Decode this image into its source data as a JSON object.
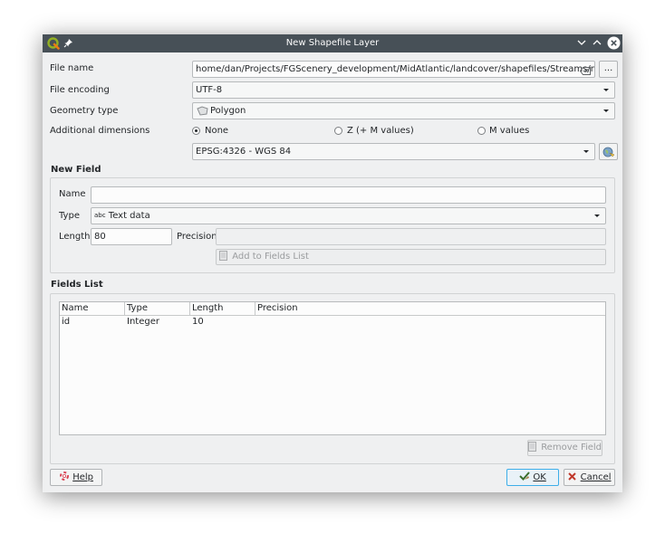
{
  "window": {
    "title": "New Shapefile Layer"
  },
  "form": {
    "file_name_label": "File name",
    "file_name_value": "home/dan/Projects/FGScenery_development/MidAtlantic/landcover/shapefiles/Streams/mask.shp",
    "browse_label": "...",
    "file_encoding_label": "File encoding",
    "file_encoding_value": "UTF-8",
    "geometry_type_label": "Geometry type",
    "geometry_type_value": "Polygon",
    "additional_dimensions_label": "Additional dimensions",
    "dimension_options": [
      "None",
      "Z (+ M values)",
      "M values"
    ],
    "dimension_selected": "None",
    "crs_value": "EPSG:4326 - WGS 84"
  },
  "new_field": {
    "title": "New Field",
    "name_label": "Name",
    "name_value": "",
    "type_label": "Type",
    "type_prefix": "abc",
    "type_value": "Text data",
    "length_label": "Length",
    "length_value": "80",
    "precision_label": "Precision",
    "precision_value": "",
    "add_button": "Add to Fields List"
  },
  "fields_list": {
    "title": "Fields List",
    "columns": [
      "Name",
      "Type",
      "Length",
      "Precision"
    ],
    "rows": [
      [
        "id",
        "Integer",
        "10",
        ""
      ]
    ],
    "remove_button": "Remove Field"
  },
  "footer": {
    "help_label": "Help",
    "ok_label": "OK",
    "cancel_label": "Cancel"
  }
}
